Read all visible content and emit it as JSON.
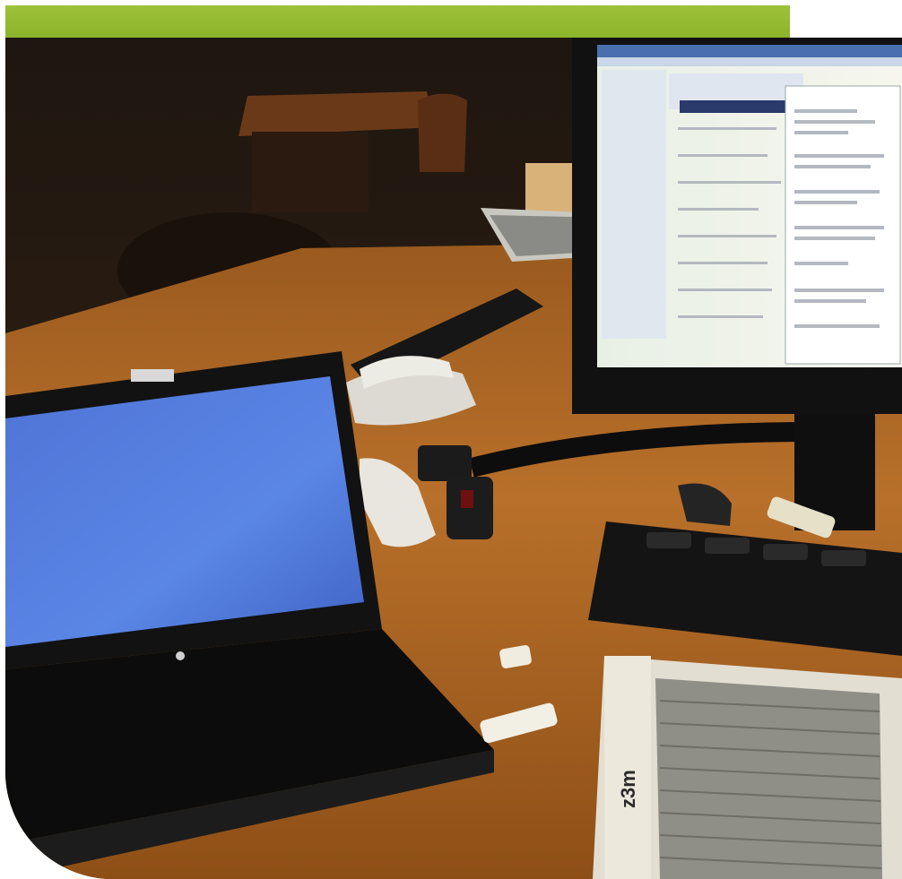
{
  "header_band": {
    "color": "#93bb33"
  },
  "photo": {
    "description_tag": "office-desk",
    "measuring_label": "z3m"
  }
}
